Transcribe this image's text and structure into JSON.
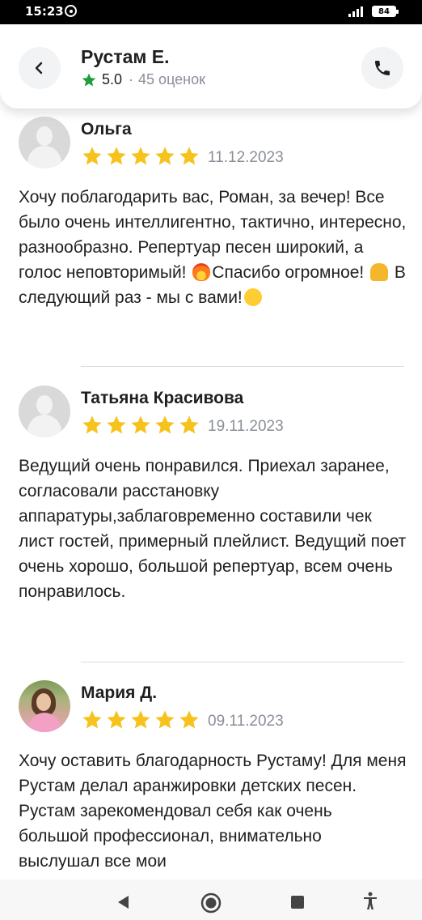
{
  "status_bar": {
    "time": "15:23",
    "battery": "84"
  },
  "header": {
    "name": "Рустам Е.",
    "rating": "5.0",
    "separator": "·",
    "reviews_count": "45 оценок"
  },
  "colors": {
    "star": "#f6c21c",
    "accent": "#1f9d3f",
    "muted": "#8a8f99"
  },
  "reviews": [
    {
      "name": "Ольга",
      "rating": 5,
      "date": "11.12.2023",
      "text_1": "Хочу поблагодарить вас, Роман, за вечер! Все было очень интеллигентно, тактично, интересно, разнообразно. Репертуар песен широкий, а голос неповторимый! ",
      "text_2": "Спасибо огромное! ",
      "text_3": " В следующий раз - мы с вами!"
    },
    {
      "name": "Татьяна Красивова",
      "rating": 5,
      "date": "19.11.2023",
      "text": "Ведущий очень понравился. Приехал заранее, согласовали расстановку аппаратуры,заблаговременно составили чек лист гостей, примерный плейлист. Ведущий поет очень хорошо, большой репертуар, всем очень понравилось."
    },
    {
      "name": "Мария Д.",
      "rating": 5,
      "date": "09.11.2023",
      "text": "Хочу оставить благодарность Рустаму! Для меня Рустам делал аранжировки детских песен. Рустам зарекомендовал себя как очень большой профессионал, внимательно выслушал все мои"
    }
  ],
  "icons": [
    "back-arrow-icon",
    "phone-icon",
    "star-icon",
    "fire-emoji-icon",
    "pray-emoji-icon",
    "smile-emoji-icon",
    "nav-back-icon",
    "nav-home-icon",
    "nav-recents-icon",
    "accessibility-icon"
  ]
}
